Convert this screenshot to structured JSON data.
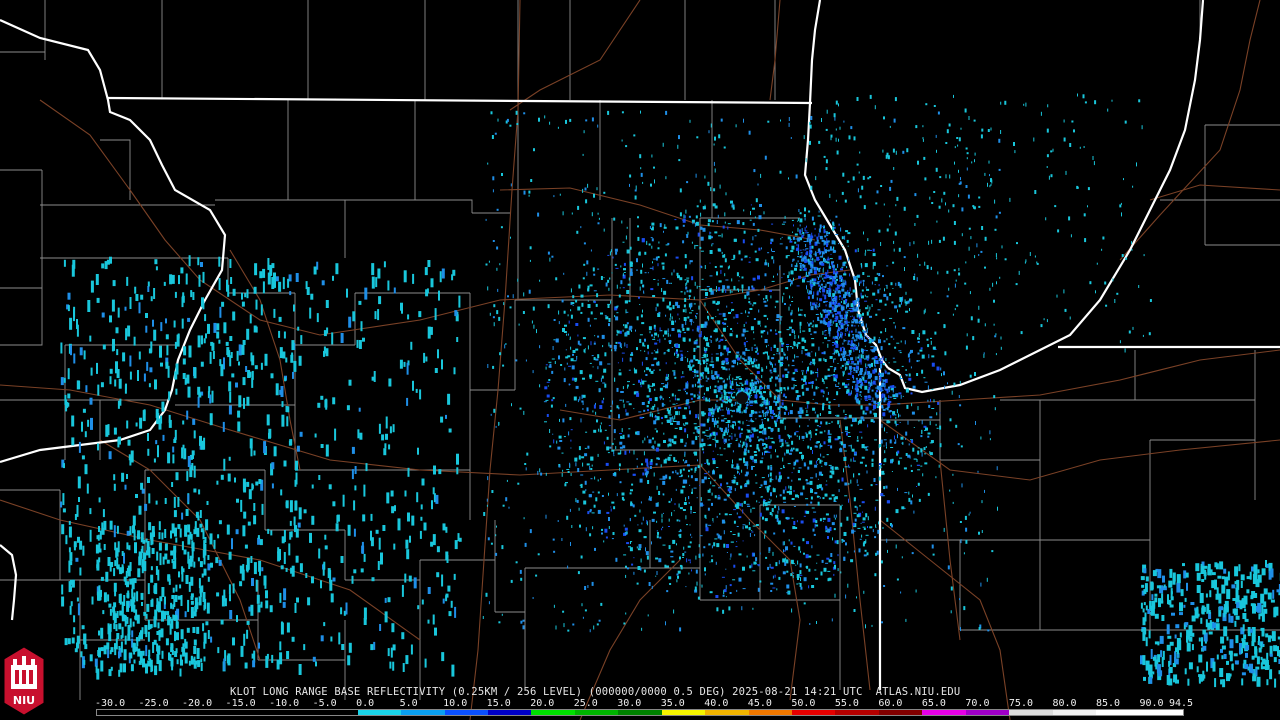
{
  "map": {
    "radar_site": "KLOT",
    "caption": "KLOT LONG RANGE BASE REFLECTIVITY (0.25KM / 256 LEVEL) (000000/0000 0.5 DEG) 2025-08-21 14:21 UTC  ATLAS.NIU.EDU",
    "logo_text": "NIU"
  },
  "scale": {
    "labels": [
      "-30.0",
      "-25.0",
      "-20.0",
      "-15.0",
      "-10.0",
      "-5.0",
      "0.0",
      "5.0",
      "10.0",
      "15.0",
      "20.0",
      "25.0",
      "30.0",
      "35.0",
      "40.0",
      "45.0",
      "50.0",
      "55.0",
      "60.0",
      "65.0",
      "70.0",
      "75.0",
      "80.0",
      "85.0",
      "90.0",
      "94.5"
    ],
    "colors": [
      "#000000",
      "#000000",
      "#000000",
      "#000000",
      "#000000",
      "#000000",
      "#1ad4e8",
      "#0aa0f0",
      "#0a50ff",
      "#0000c8",
      "#00e000",
      "#00b400",
      "#008200",
      "#f5f500",
      "#f0b400",
      "#f07800",
      "#e60000",
      "#b40000",
      "#820000",
      "#e600e6",
      "#a000c8",
      "#dcdcdc",
      "#f0f0f0",
      "#ffffff",
      "#ffffff"
    ]
  },
  "colors": {
    "background": "#000000",
    "state_border": "#ffffff",
    "county_border": "#9a9a9a",
    "roads": "#8b4a2b",
    "echo_light": "#19c7dc",
    "echo_medium": "#1f8fe8",
    "echo_strong": "#1a4cf0"
  }
}
